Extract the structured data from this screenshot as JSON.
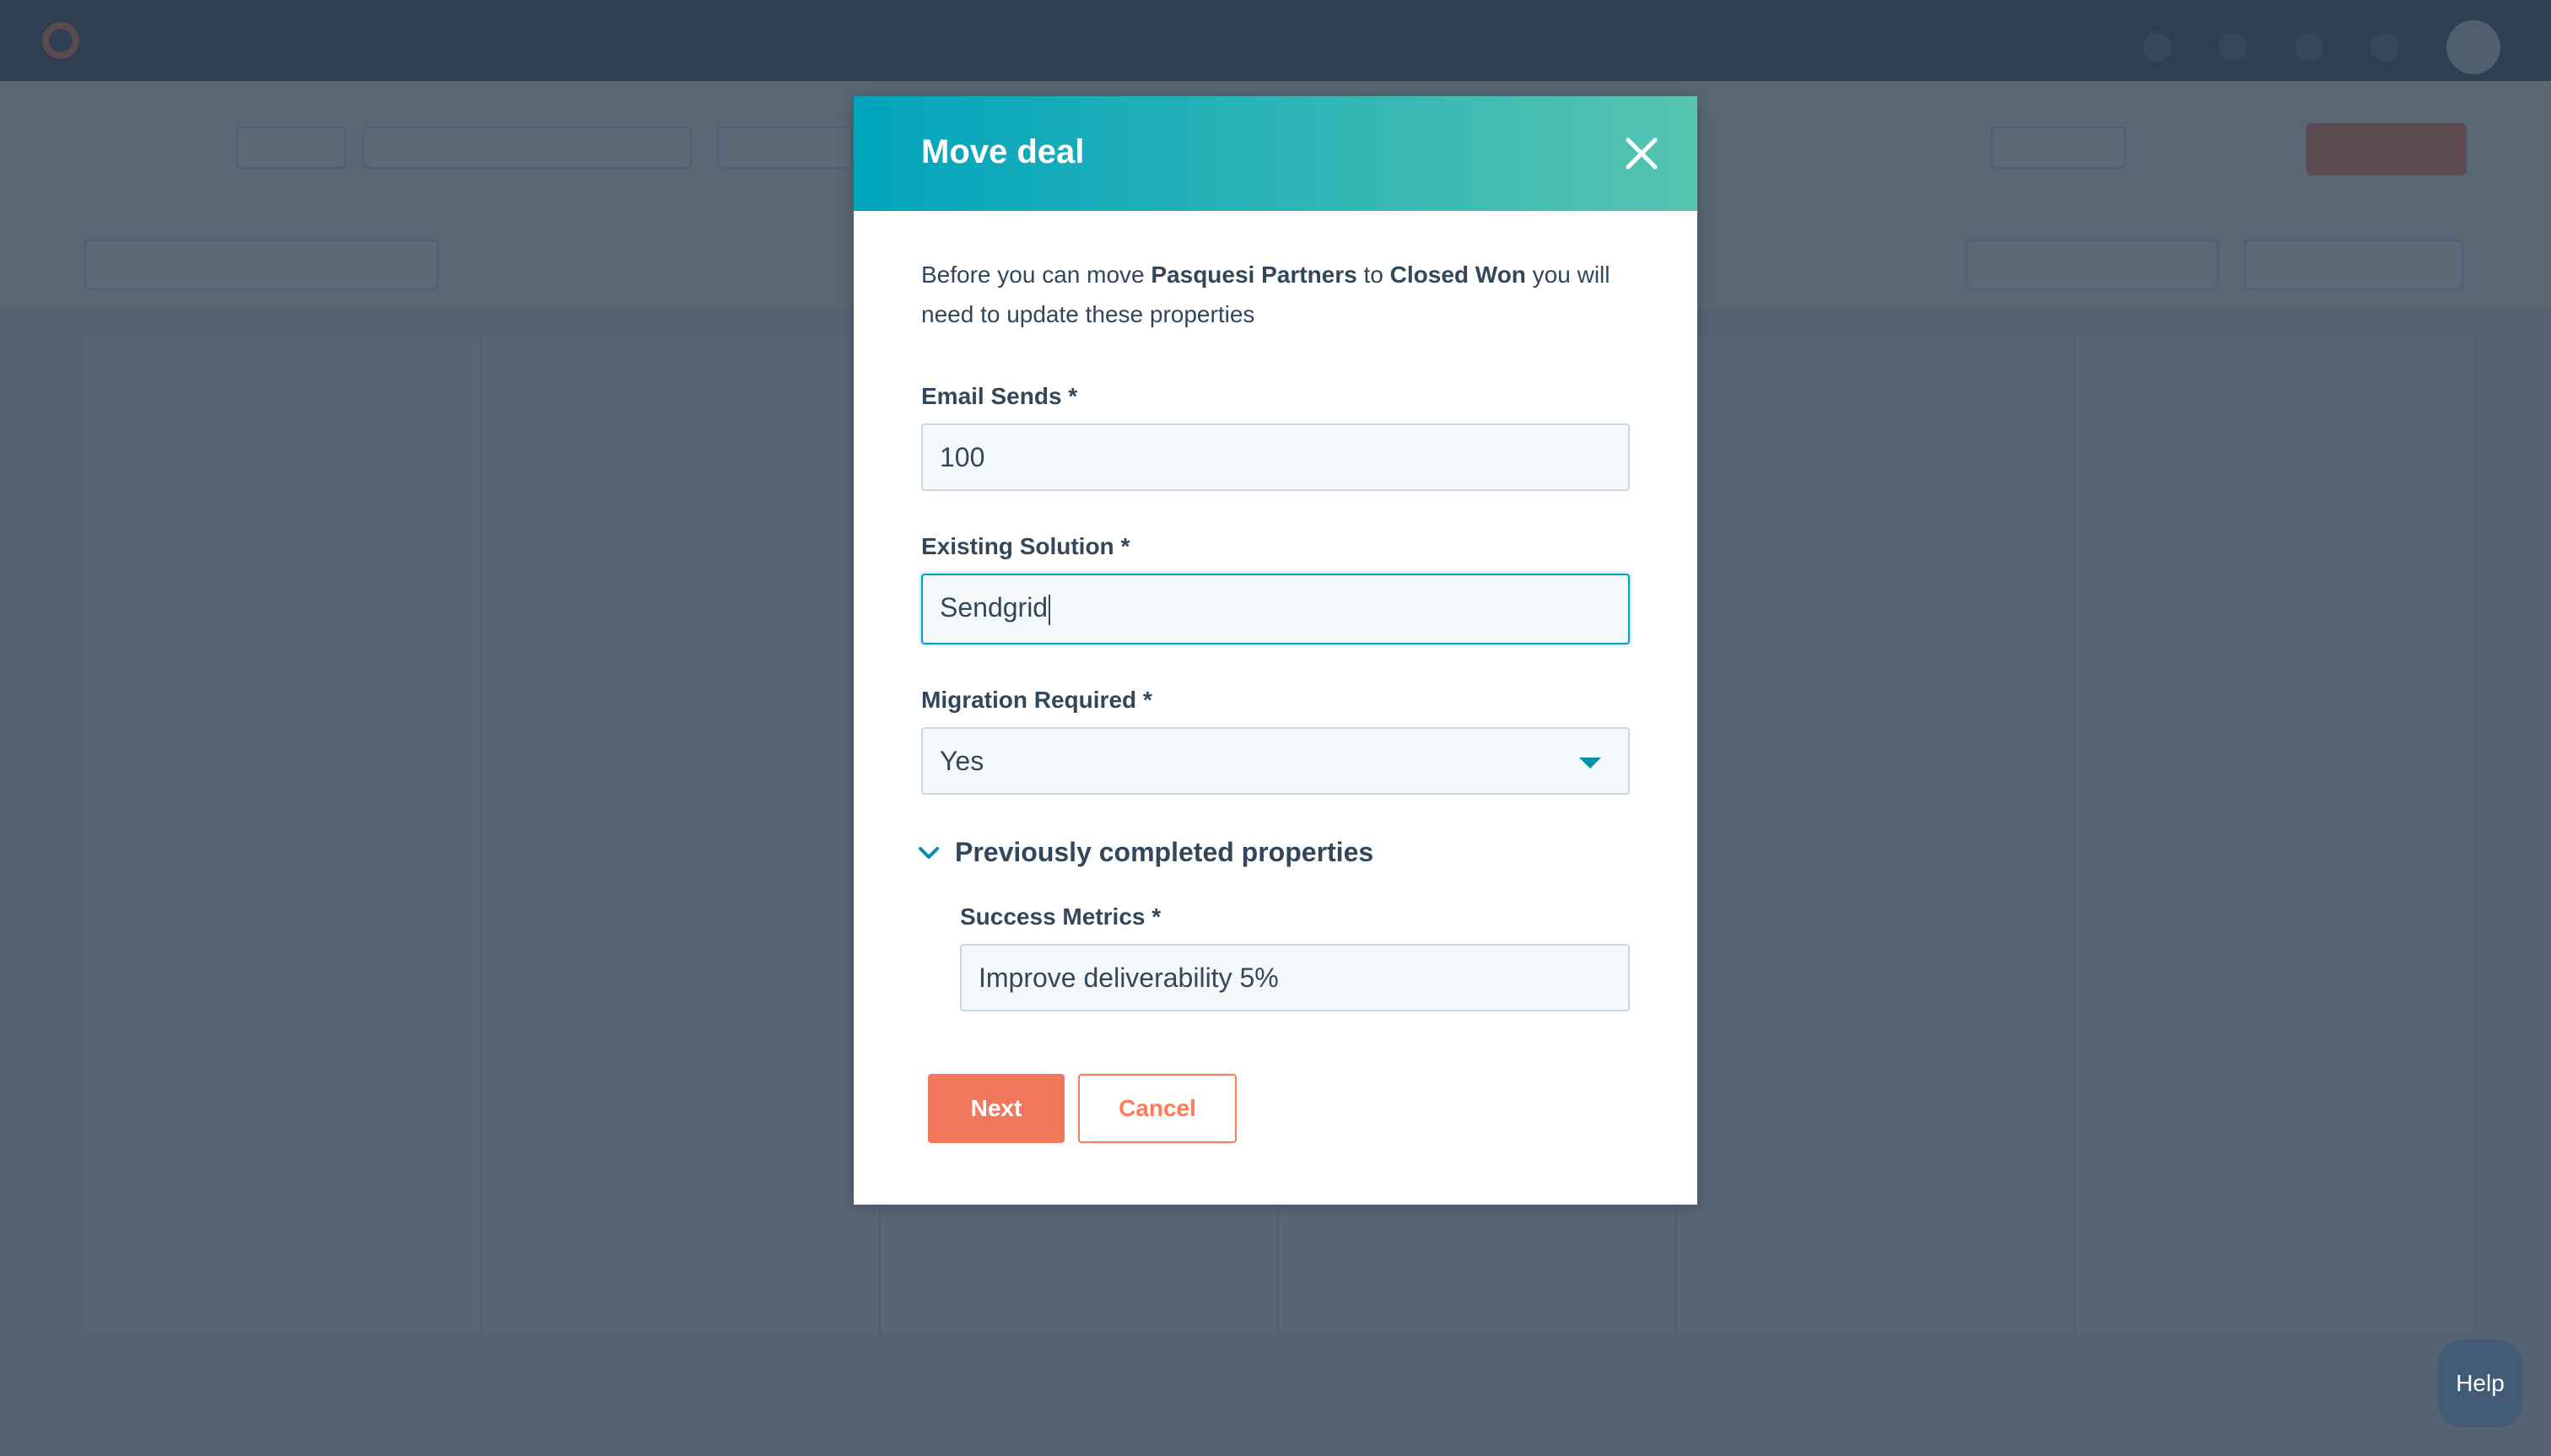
{
  "background": {
    "board_column_count": 6
  },
  "modal": {
    "title": "Move deal",
    "intro": {
      "prefix": "Before you can move ",
      "deal_name": "Pasquesi Partners",
      "middle": " to ",
      "stage": "Closed Won",
      "suffix": " you will need to update these properties"
    },
    "fields": {
      "email_sends": {
        "label": "Email Sends *",
        "value": "100"
      },
      "existing_solution": {
        "label": "Existing Solution *",
        "value": "Sendgrid"
      },
      "migration_required": {
        "label": "Migration Required *",
        "value": "Yes"
      }
    },
    "previously_completed": {
      "toggle_label": "Previously completed properties",
      "expanded": true,
      "fields": {
        "success_metrics": {
          "label": "Success Metrics *",
          "value": "Improve deliverability 5%"
        }
      }
    },
    "buttons": {
      "next": "Next",
      "cancel": "Cancel"
    }
  },
  "help": {
    "label": "Help"
  },
  "colors": {
    "header_gradient_start": "#00a4bd",
    "header_gradient_end": "#56c4b0",
    "primary_button": "#f2785b",
    "accent": "#00a4bd",
    "text": "#33475b"
  }
}
